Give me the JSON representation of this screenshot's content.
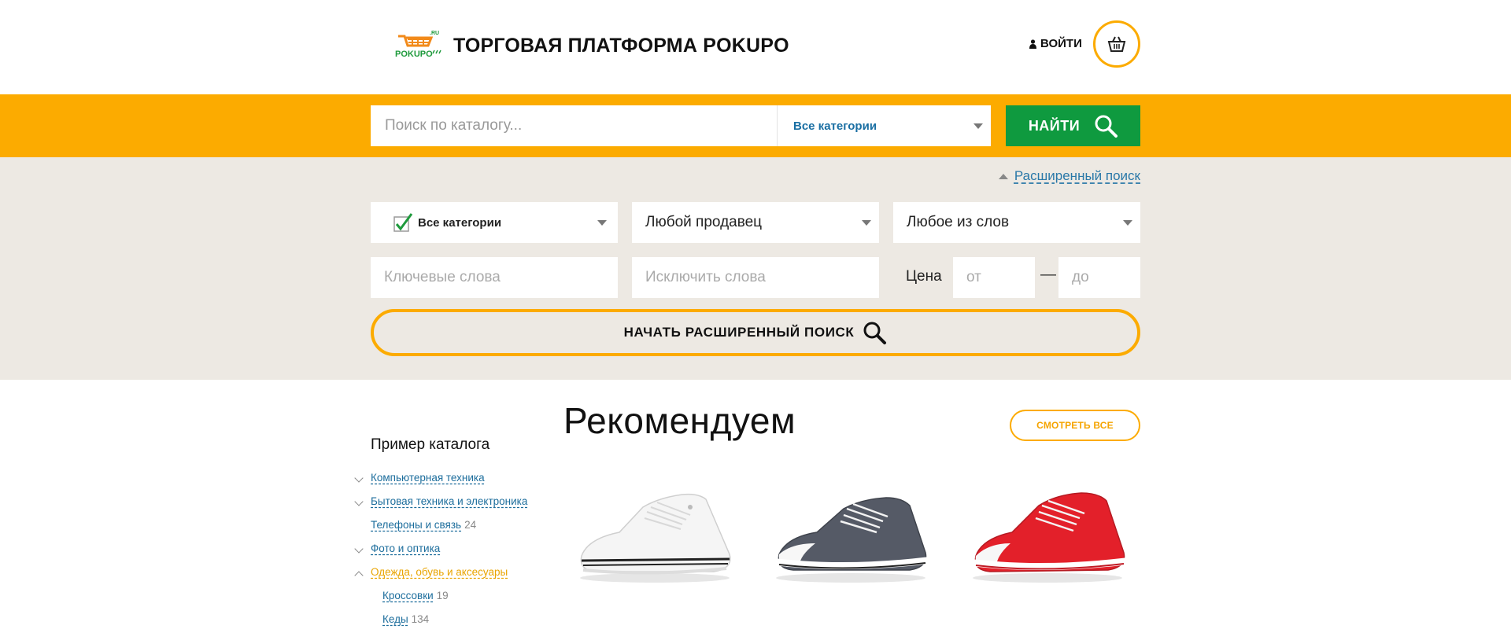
{
  "header": {
    "logo_text": "POKUPO",
    "logo_sup": ".RU",
    "site_title": "ТОРГОВАЯ ПЛАТФОРМА POKUPO",
    "login_label": "ВОЙТИ"
  },
  "search": {
    "placeholder": "Поиск по каталогу...",
    "category": "Все категории",
    "button_label": "НАЙТИ"
  },
  "advanced": {
    "link_label": "Расширенный поиск",
    "category_select": "Все категории",
    "seller_select": "Любой продавец",
    "words_select": "Любое из слов",
    "keywords_placeholder": "Ключевые слова",
    "exclude_placeholder": "Исключить слова",
    "price_label": "Цена",
    "price_from_placeholder": "от",
    "price_dash": "—",
    "price_to_placeholder": "до",
    "start_button": "НАЧАТЬ РАСШИРЕННЫЙ ПОИСК"
  },
  "catalog": {
    "title": "Пример каталога",
    "items": [
      {
        "label": "Компьютерная техника",
        "count": "",
        "chevron": "down"
      },
      {
        "label": "Бытовая техника и электроника",
        "count": "",
        "chevron": "down"
      },
      {
        "label": "Телефоны и связь",
        "count": "24",
        "chevron": "none"
      },
      {
        "label": "Фото и оптика",
        "count": "",
        "chevron": "down"
      },
      {
        "label": "Одежда, обувь и аксесуары",
        "count": "",
        "chevron": "up"
      },
      {
        "label": "Кроссовки",
        "count": "19",
        "chevron": "none"
      },
      {
        "label": "Кеды",
        "count": "134",
        "chevron": "none"
      }
    ]
  },
  "recommended": {
    "title": "Рекомендуем",
    "see_all": "СМОТРЕТЬ ВСЕ",
    "products": [
      {
        "color": "#f4f4f4",
        "icon": "white-sneaker"
      },
      {
        "color": "#555a66",
        "icon": "gray-sneaker"
      },
      {
        "color": "#e3202a",
        "icon": "red-sneaker"
      }
    ]
  },
  "colors": {
    "accent": "#fcab00",
    "green": "#0f9a3f",
    "link": "#1c6d9c",
    "band": "#ede9e3"
  }
}
